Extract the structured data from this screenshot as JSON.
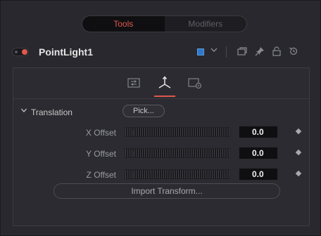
{
  "tabs": {
    "tools_label": "Tools",
    "modifiers_label": "Modifiers"
  },
  "header": {
    "node_name": "PointLight1",
    "node_color": "#2f79c7",
    "icons": [
      "chevron-down-icon",
      "copy-icon",
      "pin-icon",
      "lock-icon",
      "reset-icon"
    ]
  },
  "icon_tabs": [
    "controls-tab-icon",
    "transform-tab-icon",
    "settings-tab-icon"
  ],
  "section": {
    "label": "Translation",
    "pick_label": "Pick..."
  },
  "params": [
    {
      "label": "X Offset",
      "value": "0.0"
    },
    {
      "label": "Y Offset",
      "value": "0.0"
    },
    {
      "label": "Z Offset",
      "value": "0.0"
    }
  ],
  "import_label": "Import Transform...",
  "colors": {
    "accent": "#e0584e",
    "background": "#28282e"
  }
}
